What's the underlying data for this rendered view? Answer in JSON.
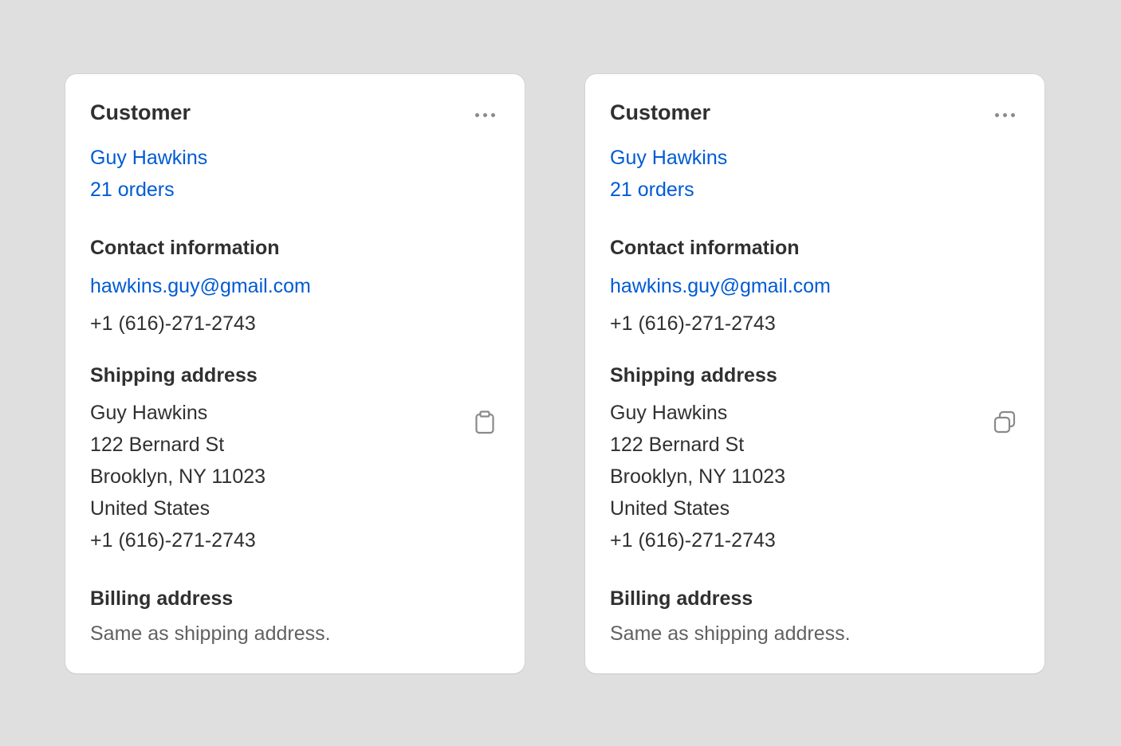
{
  "cards": [
    {
      "title": "Customer",
      "more_label": "More actions",
      "customer_name": "Guy Hawkins",
      "orders": "21 orders",
      "contact_heading": "Contact information",
      "email": "hawkins.guy@gmail.com",
      "phone": "+1 (616)-271-2743",
      "shipping_heading": "Shipping address",
      "shipping_lines": [
        "Guy Hawkins",
        "122 Bernard St",
        "Brooklyn, NY 11023",
        "United States",
        "+1 (616)-271-2743"
      ],
      "copy_icon": "clipboard-icon",
      "billing_heading": "Billing address",
      "billing_text": "Same as shipping address."
    },
    {
      "title": "Customer",
      "more_label": "More actions",
      "customer_name": "Guy Hawkins",
      "orders": "21 orders",
      "contact_heading": "Contact information",
      "email": "hawkins.guy@gmail.com",
      "phone": "+1 (616)-271-2743",
      "shipping_heading": "Shipping address",
      "shipping_lines": [
        "Guy Hawkins",
        "122 Bernard St",
        "Brooklyn, NY 11023",
        "United States",
        "+1 (616)-271-2743"
      ],
      "copy_icon": "duplicate-icon",
      "billing_heading": "Billing address",
      "billing_text": "Same as shipping address."
    }
  ],
  "colors": {
    "background": "#dfdfdf",
    "card": "#ffffff",
    "link": "#005bd3",
    "text": "#303030",
    "muted": "#616161",
    "icon": "#8a8a8a"
  }
}
